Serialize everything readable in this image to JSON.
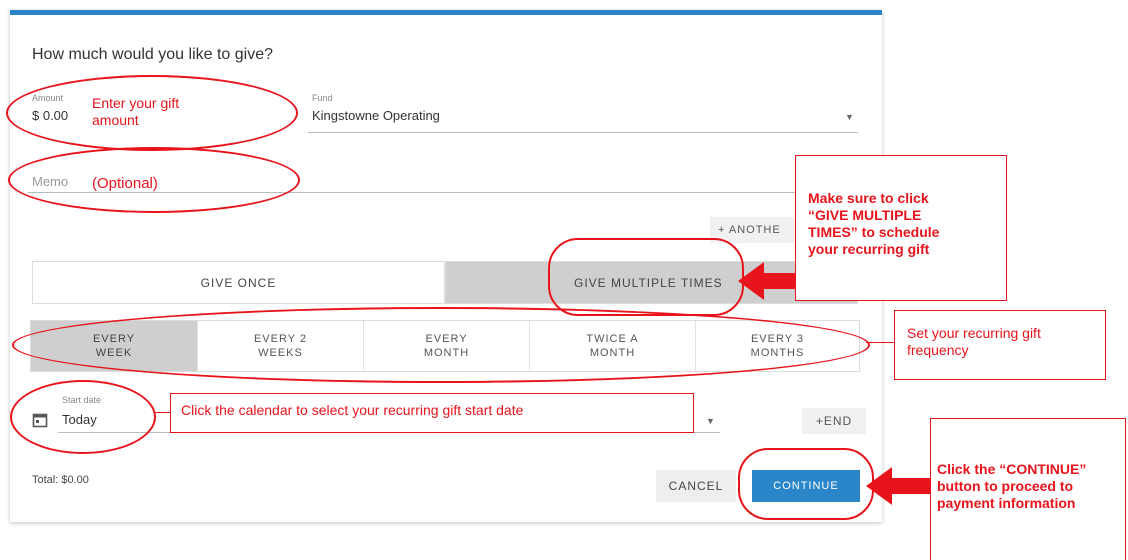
{
  "form": {
    "title": "How much would you like to give?",
    "amount_label": "Amount",
    "amount_value": "$ 0.00",
    "fund_label": "Fund",
    "fund_value": "Kingstowne Operating",
    "memo_placeholder": "Memo",
    "another_button": "+ ANOTHE",
    "give_once": "GIVE ONCE",
    "give_multiple": "GIVE MULTIPLE TIMES",
    "frequencies": [
      {
        "line1": "EVERY",
        "line2": "WEEK"
      },
      {
        "line1": "EVERY 2",
        "line2": "WEEKS"
      },
      {
        "line1": "EVERY",
        "line2": "MONTH"
      },
      {
        "line1": "TWICE A",
        "line2": "MONTH"
      },
      {
        "line1": "EVERY 3",
        "line2": "MONTHS"
      }
    ],
    "start_date_label": "Start date",
    "start_date_value": "Today",
    "end_button": "+END",
    "total": "Total: $0.00",
    "cancel_button": "CANCEL",
    "continue_button": "CONTINUE"
  },
  "annotations": {
    "amount": "Enter your gift amount",
    "amount_l1": "Enter your gift",
    "amount_l2": "amount",
    "memo": "(Optional)",
    "multiple_l1": "Make sure to click",
    "multiple_l2": "“GIVE MULTIPLE",
    "multiple_l3": "TIMES” to schedule",
    "multiple_l4": "your recurring gift",
    "frequency_l1": "Set your recurring gift",
    "frequency_l2": "frequency",
    "calendar": "Click the calendar to select your recurring gift start date",
    "continue_l1": "Click the “CONTINUE”",
    "continue_l2": "button to proceed to",
    "continue_l3": "payment information"
  },
  "colors": {
    "accent": "#2a86c8",
    "annotation": "#e8141b",
    "selected": "#cfcfcf"
  }
}
